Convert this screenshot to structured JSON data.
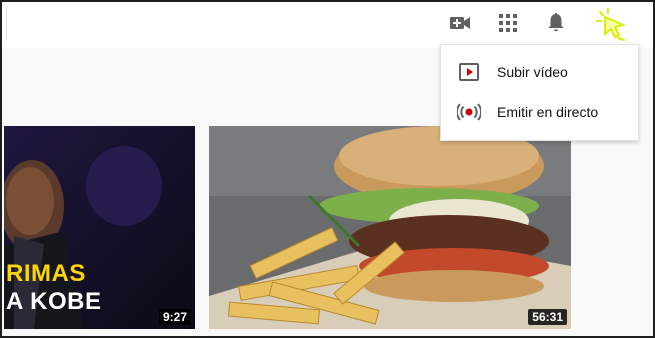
{
  "header": {
    "icons": {
      "create": "video-camera-plus-icon",
      "apps": "apps-grid-icon",
      "notifications": "bell-icon",
      "cursor": "pointer-cursor-icon"
    },
    "accent_color": "#e5ff00"
  },
  "dropdown": {
    "items": [
      {
        "label": "Subir vídeo",
        "icon": "upload-video-icon"
      },
      {
        "label": "Emitir en directo",
        "icon": "go-live-icon"
      }
    ]
  },
  "videos": [
    {
      "duration": "9:27",
      "overlay_lines": [
        "RIMAS",
        "A KOBE"
      ]
    },
    {
      "duration": "56:31"
    }
  ]
}
